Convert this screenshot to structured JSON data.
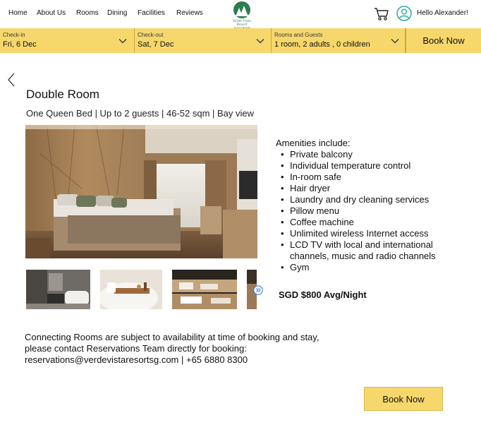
{
  "nav": {
    "links": [
      "Home",
      "About Us",
      "Rooms",
      "Dining",
      "Facilities",
      "Reviews"
    ],
    "logo_text": "Verde Vista Resort",
    "logo_subtext": "SINGAPORE",
    "greeting": "Hello Alexander!",
    "icons": [
      "cart-icon",
      "user-avatar-icon"
    ]
  },
  "booking_bar": {
    "checkin_label": "Check-in",
    "checkin_value": "Fri, 6 Dec",
    "checkout_label": "Check-out",
    "checkout_value": "Sat, 7 Dec",
    "guests_label": "Rooms and Guests",
    "guests_value": "1 room, 2 adults , 0 children",
    "book_label": "Book Now",
    "color": "#f6d76c"
  },
  "room": {
    "title": "Double Room",
    "subtitle": "One Queen Bed  | Up to 2 guests | 46-52 sqm | Bay view",
    "amenities_heading": "Amenities include:",
    "amenities": [
      "Private balcony",
      "Individual temperature control",
      "In-room safe",
      "Hair dryer",
      "Laundry and dry cleaning services",
      "Pillow menu",
      "Coffee machine",
      "Unlimited wireless Internet access",
      "LCD TV with local and international channels, music and radio channels",
      "Gym"
    ],
    "price": "SGD $800 Avg/Night"
  },
  "note": {
    "line1": "Connecting Rooms are subject to availability at time of booking and stay,",
    "line2": "please contact Reservations Team directly for booking:",
    "line3": "reservations@verdevistaresortsg.com | +65 6880 8300"
  },
  "cta": {
    "book_label": "Book Now"
  }
}
